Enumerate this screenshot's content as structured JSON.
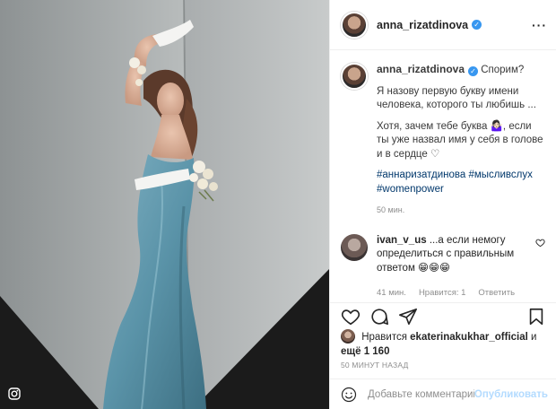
{
  "post": {
    "username": "anna_rizatdinova",
    "more_icon": "more-dots-icon",
    "verified_icon": "verified-badge-icon",
    "multi_icon": "instagram-glyph-icon"
  },
  "caption": {
    "username": "anna_rizatdinova",
    "title": "Спорим?",
    "paragraph1": "Я назову первую букву имени человека, которого ты любишь ...",
    "paragraph2": "Хотя, зачем тебе буква 🤷🏻‍♀️, если ты уже назвал имя у себя в голове и в сердце ♡",
    "hashtags": [
      "#аннаризатдинова",
      "#мысливслух",
      "#womenpower"
    ],
    "time": "50 мин."
  },
  "comment": {
    "username": "ivan_v_us",
    "text": "...а если немогу определиться с правильным ответом 😁😁😁",
    "time": "41 мин.",
    "likes_label": "Нравится: 1",
    "reply_label": "Ответить"
  },
  "likes": {
    "prefix": "Нравится",
    "user": "ekaterinakukhar_official",
    "and": "и",
    "rest": "ещё 1 160"
  },
  "post_time": "50 МИНУТ НАЗАД",
  "add_comment": {
    "placeholder": "Добавьте комментарий...",
    "publish_label": "Опубликовать"
  },
  "colors": {
    "link": "#00376b",
    "verified": "#3897f0",
    "publish_disabled": "#b3dbff",
    "muted": "#8e8e8e"
  }
}
